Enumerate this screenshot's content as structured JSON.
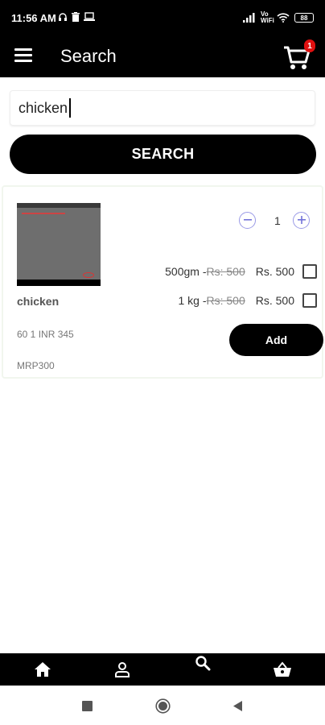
{
  "status_bar": {
    "time": "11:56 AM",
    "network_label": "Vo WiFi",
    "battery": "88"
  },
  "app_bar": {
    "title": "Search",
    "cart_count": "1"
  },
  "search": {
    "value": "chicken",
    "button_label": "SEARCH"
  },
  "product": {
    "name": "chicken",
    "meta": "60 1 INR  345",
    "mrp": "MRP300",
    "quantity": "1",
    "variants": [
      {
        "label": "500gm - ",
        "strike_price": "Rs: 500",
        "price": "Rs. 500"
      },
      {
        "label": "1 kg - ",
        "strike_price": "Rs: 500",
        "price": "Rs. 500"
      }
    ],
    "add_label": "Add"
  },
  "bottom_nav": {
    "items": [
      "home-icon",
      "profile-icon",
      "search-icon",
      "basket-icon"
    ]
  },
  "system_nav": {
    "items": [
      "recents",
      "home",
      "back"
    ]
  },
  "colors": {
    "bar_background": "#000000",
    "badge": "#e01010",
    "qty_accent": "#7373d9"
  }
}
